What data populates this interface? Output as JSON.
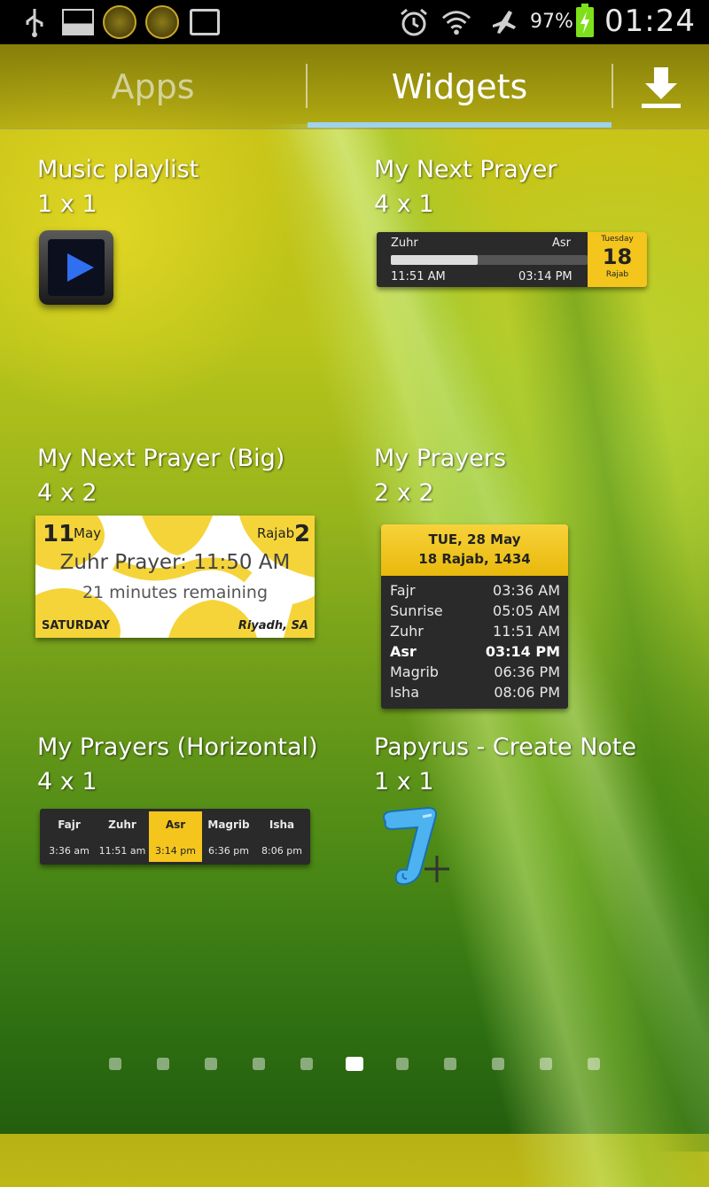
{
  "status_bar": {
    "battery_percent": "97%",
    "clock": "01:24",
    "icons": [
      "usb-icon",
      "gallery-icon",
      "app-notification-icon",
      "app-notification-icon",
      "storage-icon",
      "alarm-icon",
      "wifi-icon",
      "airplane-mode-icon",
      "battery-charging-icon"
    ]
  },
  "tabs": {
    "apps_label": "Apps",
    "widgets_label": "Widgets",
    "selected": "Widgets",
    "download_icon": "download-icon"
  },
  "widgets": [
    {
      "title": "Music playlist",
      "size": "1 x 1"
    },
    {
      "title": "My Next Prayer",
      "size": "4 x 1"
    },
    {
      "title": "My Next Prayer (Big)",
      "size": "4 x 2"
    },
    {
      "title": "My Prayers",
      "size": "2 x 2"
    },
    {
      "title": "My Prayers (Horizontal)",
      "size": "4 x 1"
    },
    {
      "title": "Papyrus - Create Note",
      "size": "1 x 1"
    }
  ],
  "next_prayer_small": {
    "left_prayer": "Zuhr",
    "right_prayer": "Asr",
    "left_time": "11:51 AM",
    "right_time": "03:14 PM",
    "progress": 0.44,
    "weekday": "Tuesday",
    "day": "18",
    "month": "Rajab"
  },
  "next_prayer_big": {
    "gregorian_day": "11",
    "gregorian_month": "May",
    "hijri_month": "Rajab",
    "hijri_day": "2",
    "headline": "Zuhr Prayer: 11:50 AM",
    "remaining": "21 minutes remaining",
    "weekday": "SATURDAY",
    "location": "Riyadh, SA"
  },
  "my_prayers": {
    "gregorian_date": "TUE, 28 May",
    "hijri_date": "18 Rajab, 1434",
    "rows": [
      {
        "name": "Fajr",
        "time": "03:36 AM"
      },
      {
        "name": "Sunrise",
        "time": "05:05 AM"
      },
      {
        "name": "Zuhr",
        "time": "11:51 AM"
      },
      {
        "name": "Asr",
        "time": "03:14 PM"
      },
      {
        "name": "Magrib",
        "time": "06:36 PM"
      },
      {
        "name": "Isha",
        "time": "08:06 PM"
      }
    ]
  },
  "my_prayers_horizontal": {
    "columns": [
      {
        "name": "Fajr",
        "time": "3:36 am"
      },
      {
        "name": "Zuhr",
        "time": "11:51 am"
      },
      {
        "name": "Asr",
        "time": "3:14 pm"
      },
      {
        "name": "Magrib",
        "time": "6:36 pm"
      },
      {
        "name": "Isha",
        "time": "8:06 pm"
      }
    ],
    "highlighted": "Asr",
    "highlight_color": "#f3c51d"
  },
  "page_indicator": {
    "total": 11,
    "current": 6
  },
  "colors": {
    "accent_blue": "#9fd2f0",
    "prayer_yellow": "#f3c51d",
    "battery_green": "#7ee01a"
  }
}
